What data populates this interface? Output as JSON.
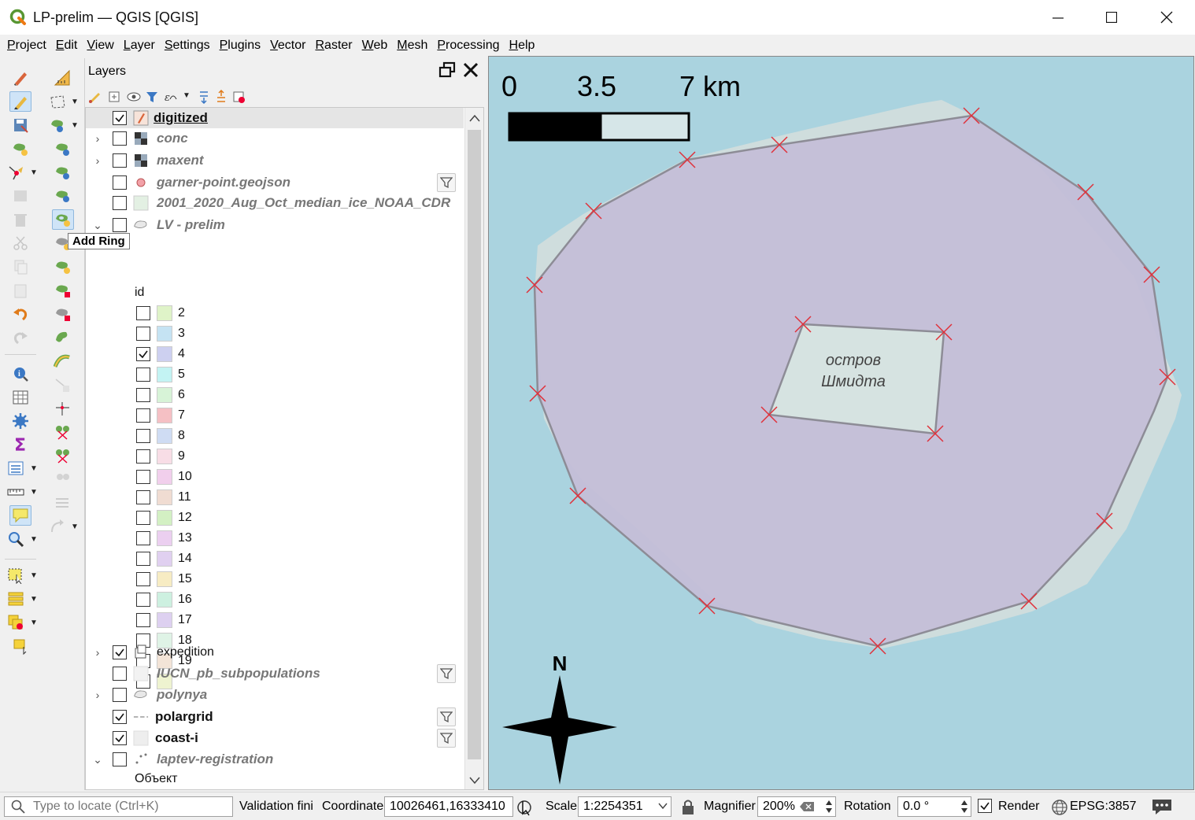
{
  "window": {
    "title": "LP-prelim — QGIS [QGIS]",
    "minimize": "–",
    "maximize": "□",
    "close": "✕"
  },
  "menu": [
    "Project",
    "Edit",
    "View",
    "Layer",
    "Settings",
    "Plugins",
    "Vector",
    "Raster",
    "Web",
    "Mesh",
    "Processing",
    "Help"
  ],
  "tooltip": "Add Ring",
  "layers_panel": {
    "title": "Layers",
    "layers": [
      {
        "name": "digitized",
        "checked": true,
        "style": "bold underline",
        "icon": "pencil-edit-icon",
        "selected": true
      },
      {
        "name": "conc",
        "checked": false,
        "style": "italic",
        "icon": "raster-icon",
        "expander": "collapsed"
      },
      {
        "name": "maxent",
        "checked": false,
        "style": "italic",
        "icon": "raster-icon",
        "expander": "collapsed"
      },
      {
        "name": "garner-point.geojson",
        "checked": false,
        "style": "italic",
        "icon": "point-icon",
        "filter": true
      },
      {
        "name": "2001_2020_Aug_Oct_median_ice_NOAA_CDR",
        "checked": false,
        "style": "italic",
        "icon": "polygon-fill-icon"
      },
      {
        "name": "LV - prelim",
        "checked": false,
        "style": "italic",
        "icon": "polygon-icon",
        "expander": "expanded"
      }
    ],
    "legend_header": "id",
    "legend": [
      {
        "label": "2",
        "checked": false,
        "color": "#dff3c8"
      },
      {
        "label": "3",
        "checked": false,
        "color": "#c5e3f3"
      },
      {
        "label": "4",
        "checked": true,
        "color": "#cdd0f0"
      },
      {
        "label": "5",
        "checked": false,
        "color": "#c3f3f3"
      },
      {
        "label": "6",
        "checked": false,
        "color": "#d7f3d7"
      },
      {
        "label": "7",
        "checked": false,
        "color": "#f5c0c4"
      },
      {
        "label": "8",
        "checked": false,
        "color": "#cfdcf3"
      },
      {
        "label": "9",
        "checked": false,
        "color": "#f8dde6"
      },
      {
        "label": "10",
        "checked": false,
        "color": "#f1cfec"
      },
      {
        "label": "11",
        "checked": false,
        "color": "#f0dcd2"
      },
      {
        "label": "12",
        "checked": false,
        "color": "#d3f0c3"
      },
      {
        "label": "13",
        "checked": false,
        "color": "#ebcff0"
      },
      {
        "label": "14",
        "checked": false,
        "color": "#e0d0f0"
      },
      {
        "label": "15",
        "checked": false,
        "color": "#f7ecc3"
      },
      {
        "label": "16",
        "checked": false,
        "color": "#cdf0e0"
      },
      {
        "label": "17",
        "checked": false,
        "color": "#ddd0f0"
      },
      {
        "label": "18",
        "checked": false,
        "color": "#dff3e6"
      },
      {
        "label": "19",
        "checked": false,
        "color": "#f3e4d7"
      },
      {
        "label": "",
        "checked": false,
        "color": "#eef3d0"
      }
    ],
    "layers_after": [
      {
        "name": "expedition",
        "checked": true,
        "style": "plain",
        "icon": "group-icon",
        "expander": "collapsed"
      },
      {
        "name": "IUCN_pb_subpopulations",
        "checked": false,
        "style": "italic",
        "icon": "polygon-fill-icon",
        "filter": true
      },
      {
        "name": "polynya",
        "checked": false,
        "style": "italic",
        "icon": "polygon-icon",
        "expander": "collapsed"
      },
      {
        "name": "polargrid",
        "checked": true,
        "style": "bold",
        "icon": "line-dash-icon",
        "filter": true
      },
      {
        "name": "coast-i",
        "checked": true,
        "style": "bold",
        "icon": "polygon-fill-icon",
        "filter": true
      },
      {
        "name": "laptev-registration",
        "checked": false,
        "style": "italic",
        "icon": "points-icon",
        "expander": "expanded"
      }
    ],
    "sub_legend_label": "Объект"
  },
  "map": {
    "scalebar": {
      "labels": [
        "0",
        "3.5",
        "7 km"
      ]
    },
    "island_label_line1": "остров",
    "island_label_line2": "Шмидта",
    "north": "N",
    "colors": {
      "sea": "#aad3df",
      "polygon_fill": "#c6c0d6",
      "island": "#d6e3e1",
      "vertex": "#e0303a",
      "edge": "#8d8c96"
    }
  },
  "status": {
    "locate_placeholder": "Type to locate (Ctrl+K)",
    "message": "Validation fini",
    "coordinate_label": "Coordinate",
    "coordinate": "10026461,16333410",
    "scale_label": "Scale",
    "scale": "1:2254351",
    "magnifier_label": "Magnifier",
    "magnifier": "200%",
    "rotation_label": "Rotation",
    "rotation": "0.0 °",
    "render_label": "Render",
    "crs": "EPSG:3857"
  }
}
